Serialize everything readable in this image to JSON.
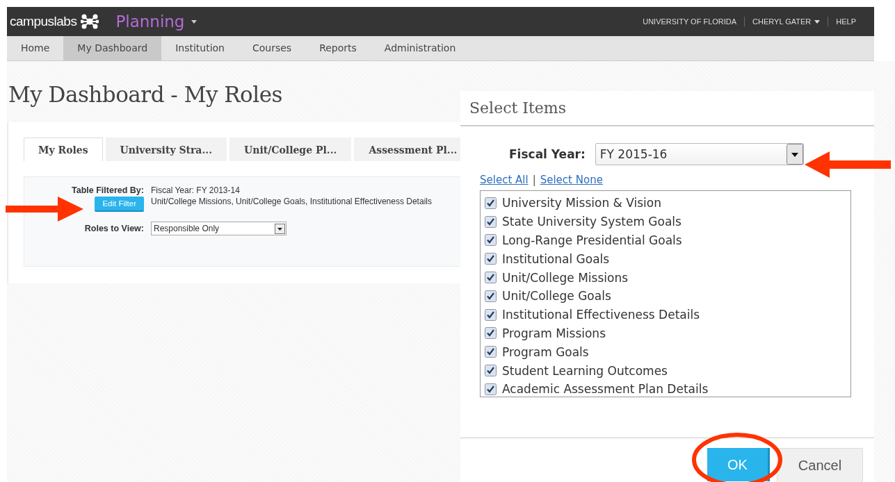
{
  "header": {
    "brand": "campuslabs",
    "app": "Planning",
    "links": [
      {
        "label": "UNIVERSITY OF FLORIDA",
        "dropdown": false
      },
      {
        "label": "CHERYL GATER",
        "dropdown": true
      },
      {
        "label": "HELP",
        "dropdown": false
      }
    ]
  },
  "nav": [
    {
      "label": "Home",
      "selected": false
    },
    {
      "label": "My Dashboard",
      "selected": true
    },
    {
      "label": "Institution",
      "selected": false
    },
    {
      "label": "Courses",
      "selected": false
    },
    {
      "label": "Reports",
      "selected": false
    },
    {
      "label": "Administration",
      "selected": false
    }
  ],
  "page_title": "My Dashboard - My Roles",
  "tabs": [
    {
      "label": "My Roles",
      "selected": true
    },
    {
      "label": "University Stra...",
      "selected": false
    },
    {
      "label": "Unit/College Pl...",
      "selected": false
    },
    {
      "label": "Assessment Pl...",
      "selected": false
    }
  ],
  "filter": {
    "label": "Table Filtered By:",
    "lines": [
      "Fiscal Year: FY 2013-14",
      "Unit/College Missions, Unit/College Goals, Institutional Effectiveness Details"
    ],
    "button": "Edit Filter"
  },
  "roles": {
    "label": "Roles to View:",
    "value": "Responsible Only"
  },
  "dialog": {
    "title": "Select Items",
    "fiscal_label": "Fiscal Year:",
    "fiscal_value": "FY 2015-16",
    "select_all": "Select All",
    "separator": "|",
    "select_none": "Select None",
    "items": [
      {
        "label": "University Mission & Vision",
        "checked": true
      },
      {
        "label": "State University System Goals",
        "checked": true
      },
      {
        "label": "Long-Range Presidential Goals",
        "checked": true
      },
      {
        "label": "Institutional Goals",
        "checked": true
      },
      {
        "label": "Unit/College Missions",
        "checked": true
      },
      {
        "label": "Unit/College Goals",
        "checked": true
      },
      {
        "label": "Institutional Effectiveness Details",
        "checked": true
      },
      {
        "label": "Program Missions",
        "checked": true
      },
      {
        "label": "Program Goals",
        "checked": true
      },
      {
        "label": "Student Learning Outcomes",
        "checked": true
      },
      {
        "label": "Academic Assessment Plan Details",
        "checked": true
      }
    ],
    "ok": "OK",
    "cancel": "Cancel"
  }
}
